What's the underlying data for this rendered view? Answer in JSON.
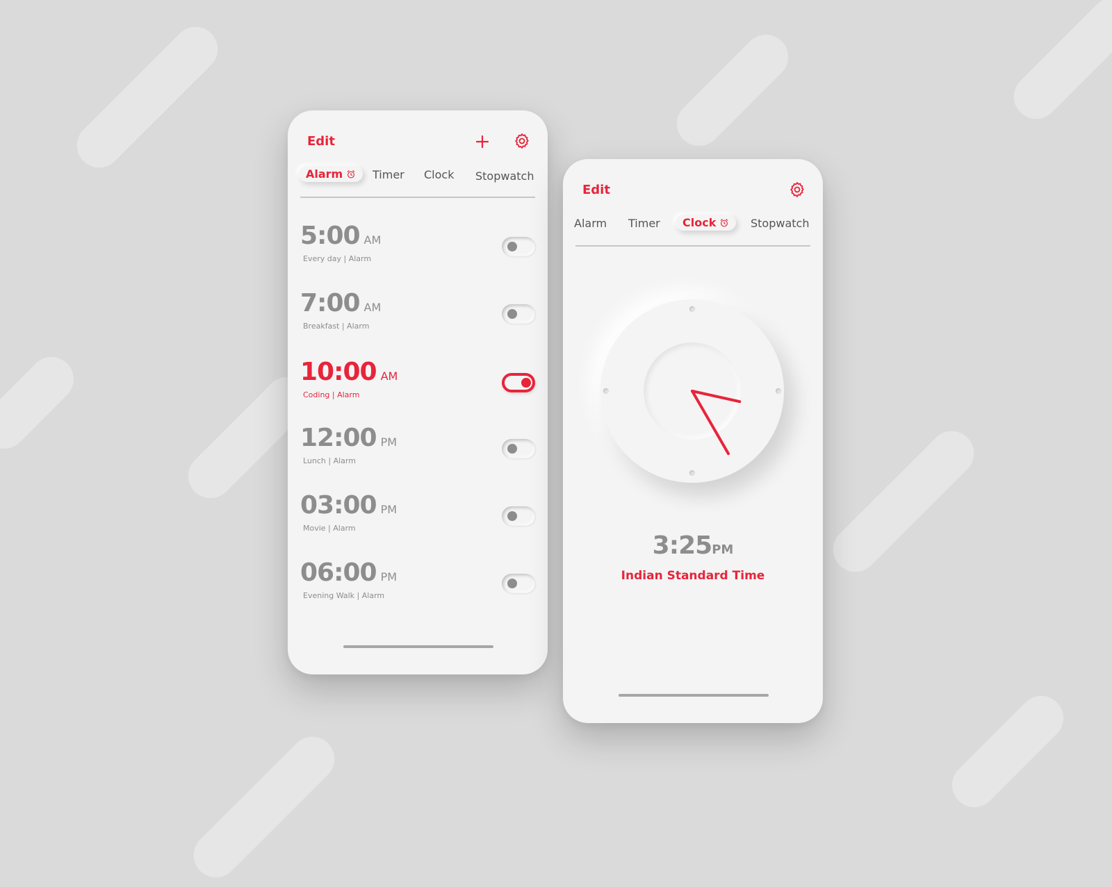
{
  "colors": {
    "accent": "#e8243a",
    "muted": "#8d8d8d",
    "background": "#dadada",
    "card": "#f4f4f4"
  },
  "alarm_screen": {
    "edit_label": "Edit",
    "add_icon": "plus-icon",
    "settings_icon": "gear-icon",
    "tabs": [
      {
        "label": "Alarm",
        "active": true
      },
      {
        "label": "Timer",
        "active": false
      },
      {
        "label": "Clock",
        "active": false
      },
      {
        "label": "Stopwatch",
        "active": false
      }
    ],
    "alarms": [
      {
        "time": "5:00",
        "ampm": "AM",
        "subtitle": "Every day | Alarm",
        "on": false
      },
      {
        "time": "7:00",
        "ampm": "AM",
        "subtitle": "Breakfast | Alarm",
        "on": false
      },
      {
        "time": "10:00",
        "ampm": "AM",
        "subtitle": "Coding | Alarm",
        "on": true
      },
      {
        "time": "12:00",
        "ampm": "PM",
        "subtitle": "Lunch | Alarm",
        "on": false
      },
      {
        "time": "03:00",
        "ampm": "PM",
        "subtitle": "Movie | Alarm",
        "on": false
      },
      {
        "time": "06:00",
        "ampm": "PM",
        "subtitle": "Evening Walk | Alarm",
        "on": false
      }
    ]
  },
  "clock_screen": {
    "edit_label": "Edit",
    "settings_icon": "gear-icon",
    "tabs": [
      {
        "label": "Alarm",
        "active": false
      },
      {
        "label": "Timer",
        "active": false
      },
      {
        "label": "Clock",
        "active": true
      },
      {
        "label": "Stopwatch",
        "active": false
      }
    ],
    "time": "3:25",
    "ampm": "PM",
    "timezone": "Indian Standard Time",
    "hour": 3,
    "minute": 25
  }
}
